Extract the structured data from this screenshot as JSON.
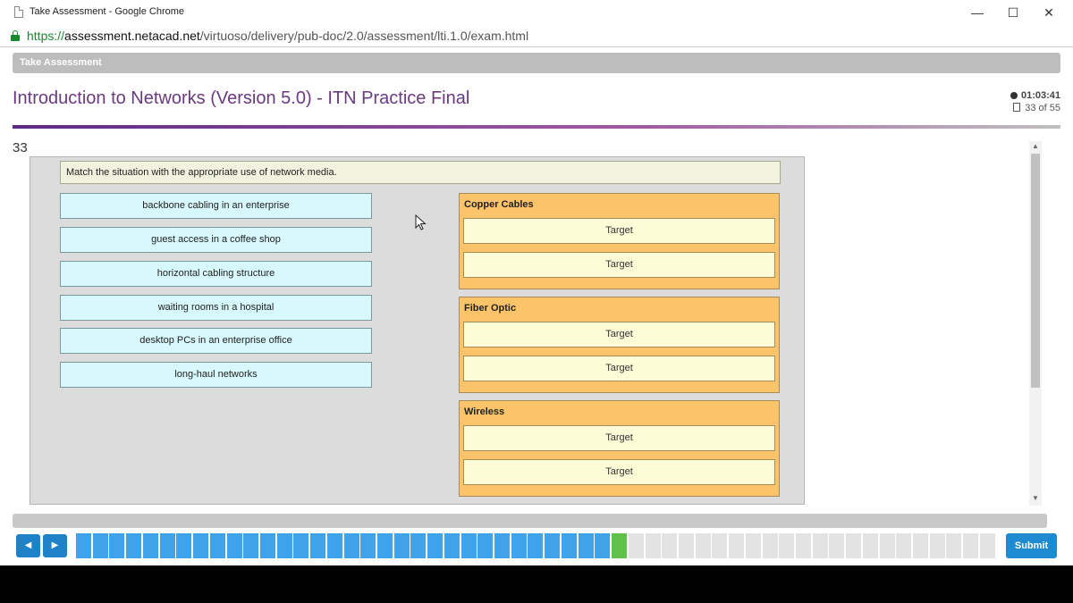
{
  "window": {
    "title": "Take Assessment - Google Chrome",
    "minimize": "—",
    "maximize": "☐",
    "close": "✕"
  },
  "address": {
    "scheme": "https://",
    "host": "assessment.netacad.net",
    "path": "/virtuoso/delivery/pub-doc/2.0/assessment/lti.1.0/exam.html"
  },
  "header": {
    "label": "Take Assessment"
  },
  "exam": {
    "title": "Introduction to Networks (Version 5.0) - ITN Practice Final",
    "timer": "01:03:41",
    "progress_text": "33 of 55"
  },
  "question": {
    "number": "33",
    "prompt": "Match the situation with the appropriate use of network media.",
    "sources": [
      "backbone cabling in an enterprise",
      "guest access in a coffee shop",
      "horizontal cabling structure",
      "waiting rooms in a hospital",
      "desktop PCs in an enterprise office",
      "long-haul networks"
    ],
    "groups": [
      {
        "title": "Copper Cables",
        "targets": [
          "Target",
          "Target"
        ]
      },
      {
        "title": "Fiber Optic",
        "targets": [
          "Target",
          "Target"
        ]
      },
      {
        "title": "Wireless",
        "targets": [
          "Target",
          "Target"
        ]
      }
    ]
  },
  "navigation": {
    "prev": "◀",
    "next": "▶",
    "submit": "Submit",
    "total_questions": 55,
    "current_question": 33
  },
  "colors": {
    "answered": "#3ea3e8",
    "current": "#5fc04a",
    "unanswered": "#e3e3e3",
    "accent": "#6b3a7f"
  }
}
